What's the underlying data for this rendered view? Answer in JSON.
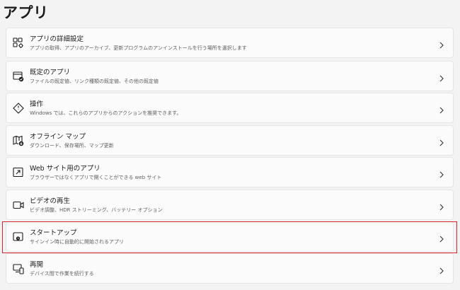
{
  "page": {
    "title": "アプリ"
  },
  "items": [
    {
      "title": "アプリの詳細設定",
      "desc": "アプリの取得、アプリのアーカイブ、更新プログラムのアンインストールを行う場所を選択します",
      "icon": "advanced-apps-icon"
    },
    {
      "title": "既定のアプリ",
      "desc": "ファイルの既定値、リンク種類の既定値、その他の既定値",
      "icon": "default-apps-icon"
    },
    {
      "title": "操作",
      "desc": "Windows では、これらのアプリからのアクションを推奨できます。",
      "icon": "actions-icon"
    },
    {
      "title": "オフライン マップ",
      "desc": "ダウンロード、保存場所、マップ更新",
      "icon": "offline-maps-icon"
    },
    {
      "title": "Web サイト用のアプリ",
      "desc": "ブラウザーではなくアプリで開くことができる web サイト",
      "icon": "apps-for-websites-icon"
    },
    {
      "title": "ビデオの再生",
      "desc": "ビデオ調整、HDR ストリーミング、バッテリー オプション",
      "icon": "video-playback-icon"
    },
    {
      "title": "スタートアップ",
      "desc": "サインイン時に自動的に開始されるアプリ",
      "icon": "startup-icon"
    },
    {
      "title": "再開",
      "desc": "デバイス間で作業を続行する",
      "icon": "resume-icon"
    }
  ],
  "highlight": {
    "target": "スタートアップ",
    "color": "#d9232d"
  }
}
